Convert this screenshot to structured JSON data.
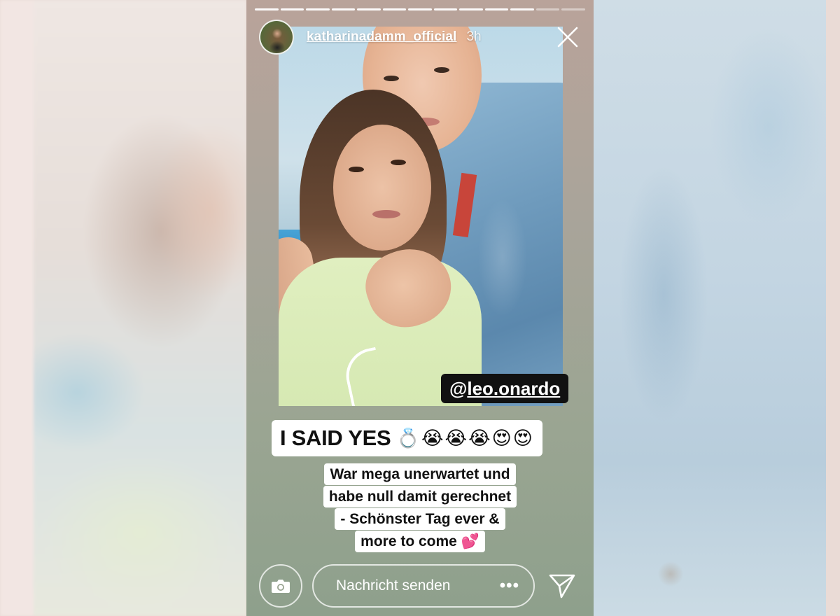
{
  "story": {
    "username": "katharinadamm_official",
    "time_ago": "3h",
    "progress": {
      "total_segments": 13,
      "completed_segments": 11
    },
    "mention": {
      "prefix": "@",
      "name": "leo.onardo"
    },
    "caption_main": {
      "text": "I SAID YES",
      "emojis": "💍😭😭😭😍😍"
    },
    "caption_sub": [
      "War mega unerwartet und",
      "habe null damit gerechnet",
      "- Schönster Tag ever &",
      "more to come"
    ],
    "caption_sub_emoji": "💕"
  },
  "reply_bar": {
    "placeholder": "Nachricht senden",
    "more_label": "•••"
  },
  "icons": {
    "close": "close-icon",
    "camera": "camera-icon",
    "send": "send-icon"
  },
  "colors": {
    "mention_bg": "#111111",
    "caption_bg": "#ffffff",
    "heart": "#e8469b"
  }
}
